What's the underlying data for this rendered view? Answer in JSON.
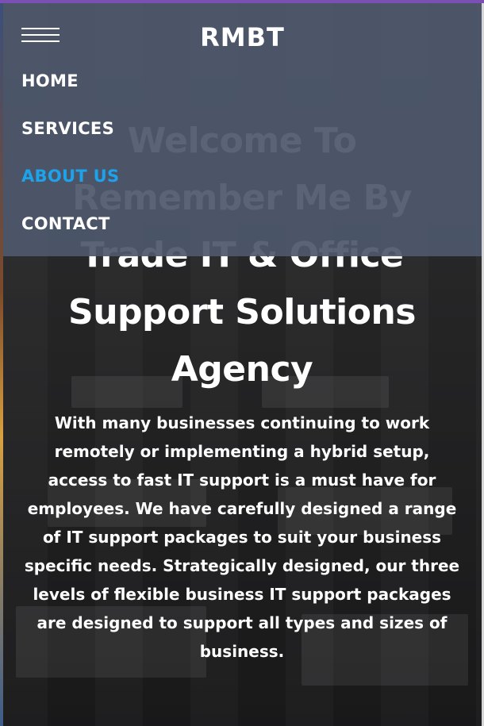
{
  "nav": {
    "brand": "RMBT",
    "items": [
      {
        "label": "HOME"
      },
      {
        "label": "SERVICES"
      },
      {
        "label": "ABOUT US"
      },
      {
        "label": "CONTACT"
      }
    ],
    "active_item": "ABOUT US",
    "active_color": "#1ca3ec",
    "icon": "hamburger-menu-icon"
  },
  "hero": {
    "title": "Welcome To Remember Me By Trade IT & Office Support Solutions Agency",
    "text": "With many businesses continuing to work remotely or implementing a hybrid setup, access to fast IT support is a must have for employees. We have carefully designed a range of IT support packages to suit your business specific needs. Strategically designed, our three levels of flexible business IT support packages are designed to support all types and sizes of business."
  },
  "colors": {
    "top_accent": "#7b4fb4",
    "nav_background": "#4e586c",
    "text": "#ffffff"
  }
}
